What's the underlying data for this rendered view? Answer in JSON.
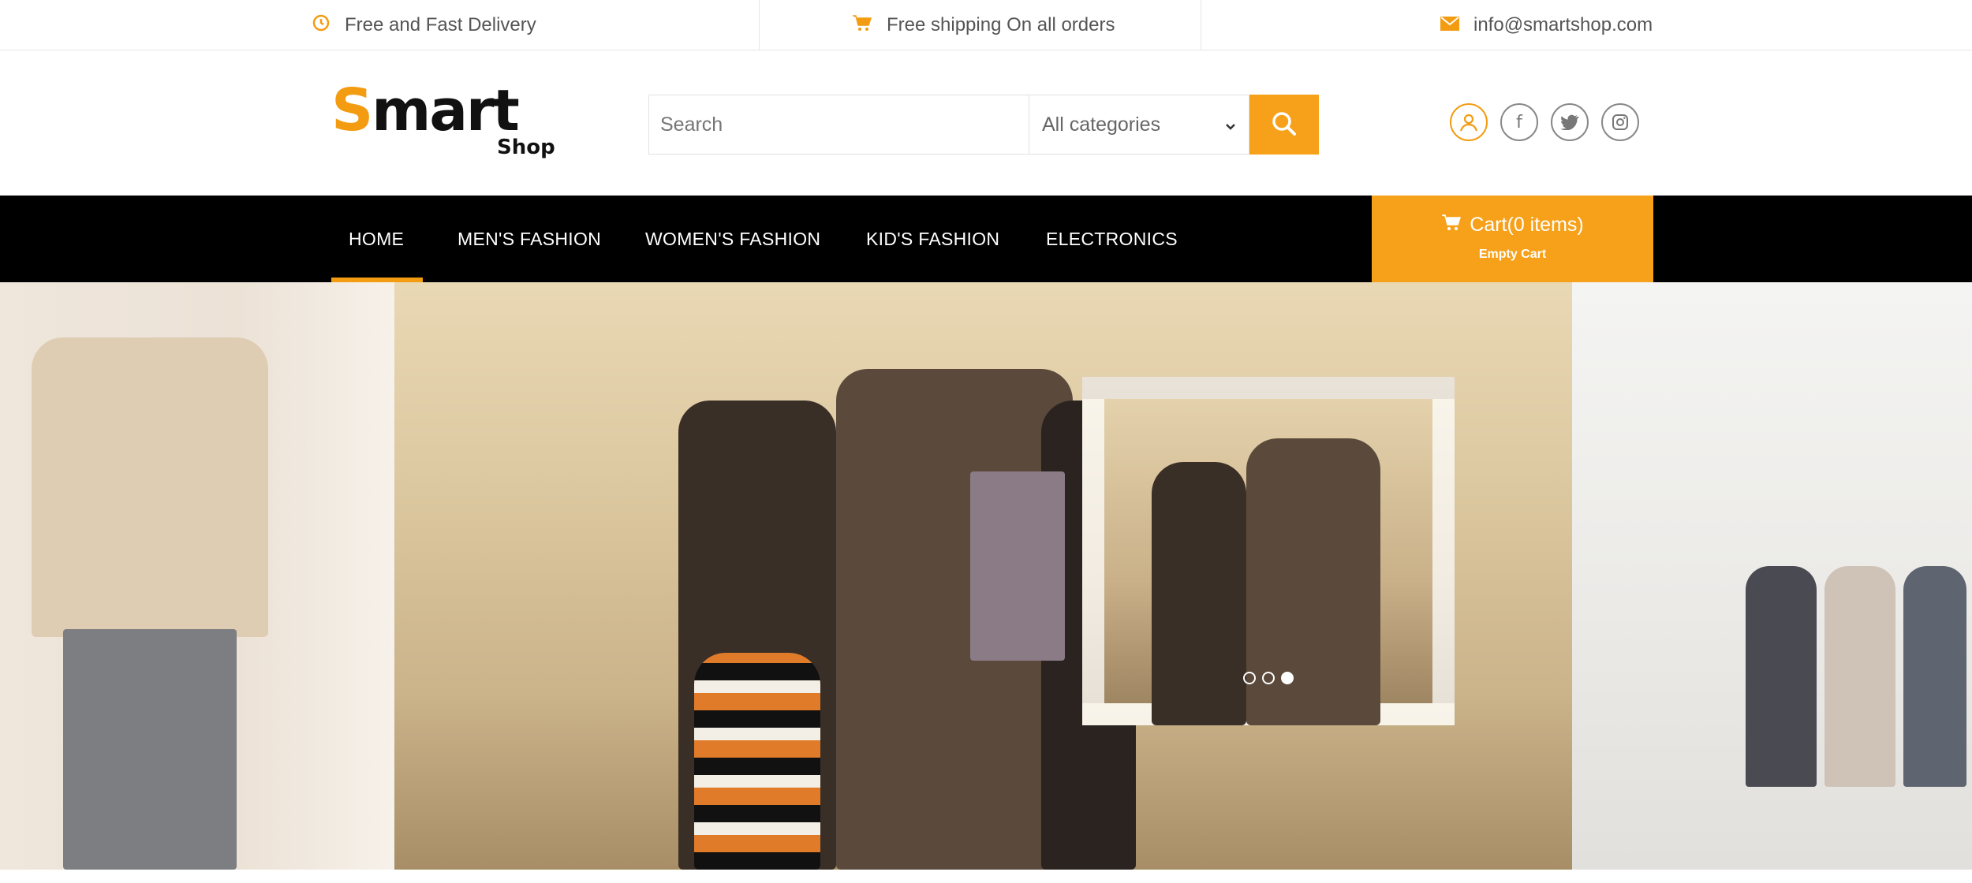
{
  "topbar": {
    "delivery": "Free and Fast Delivery",
    "shipping": "Free shipping On all orders",
    "email": "info@smartshop.com"
  },
  "logo": {
    "main": "mart",
    "sub": "Shop"
  },
  "search": {
    "placeholder": "Search",
    "category": "All categories"
  },
  "nav": {
    "items": [
      {
        "label": "HOME"
      },
      {
        "label": "MEN'S FASHION"
      },
      {
        "label": "WOMEN'S FASHION"
      },
      {
        "label": "KID'S FASHION"
      },
      {
        "label": "ELECTRONICS"
      }
    ]
  },
  "cart": {
    "title": "Cart(0 items)",
    "subtitle": "Empty Cart"
  },
  "slider": {
    "slide_count": 3,
    "active_slide": 3
  },
  "colors": {
    "accent": "#f7a11a",
    "nav_bg": "#000000"
  }
}
